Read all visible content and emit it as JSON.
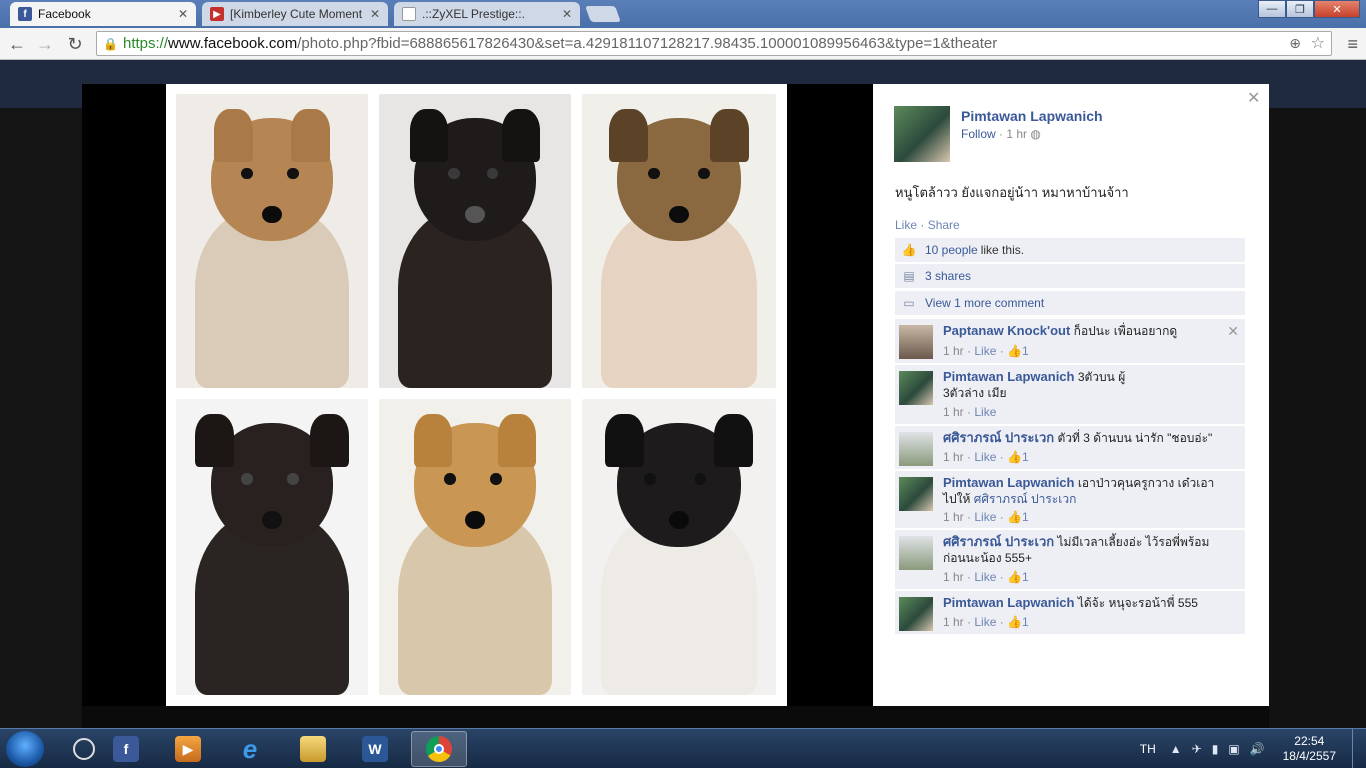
{
  "tabs": [
    {
      "label": "Facebook",
      "icon": "facebook-icon",
      "active": true
    },
    {
      "label": "[Kimberley Cute Moment",
      "icon": "youtube-icon",
      "active": false
    },
    {
      "label": ".::ZyXEL Prestige::.",
      "icon": "page-icon",
      "active": false
    }
  ],
  "window": {
    "minimize": "—",
    "maximize": "❐",
    "close": "✕"
  },
  "omnibox": {
    "scheme": "https://",
    "host": "www.facebook.com",
    "path": "/photo.php?fbid=688865617826430&set=a.429181107128217.98435.100001089956463&type=1&theater"
  },
  "post": {
    "owner_name": "Pimtawan Lapwanich",
    "follow": "Follow",
    "separator": " · ",
    "time": "1 hr",
    "caption": "หนูโตล้าวว ยังแจกอยู่น้าา หมาหาบ้านจ้าา",
    "like": "Like",
    "share": "Share",
    "likes_link": "10 people",
    "likes_text": "like this.",
    "shares": "3 shares",
    "more_comments": "View 1 more comment"
  },
  "comments": [
    {
      "name": "Paptanaw Knock'out",
      "text": "ก็อปนะ เพื่อนอยากดู",
      "time": "1 hr",
      "like": "Like",
      "likes": "1",
      "closable": true
    },
    {
      "name": "Pimtawan Lapwanich",
      "text": "3ตัวบน ผู้",
      "text2": "3ตัวล่าง เมีย",
      "time": "1 hr",
      "like": "Like",
      "likes": ""
    },
    {
      "name": "ศศิราภรณ์ ปาระเวก",
      "text": "ตัวที่ 3 ด้านบน น่ารัก \"ชอบอ่ะ\"",
      "time": "1 hr",
      "like": "Like",
      "likes": "1"
    },
    {
      "name": "Pimtawan Lapwanich",
      "text": "เอาป่าวคุนครูกวาง เด๋วเอา",
      "text2_plain": "ไปให้ ",
      "text2_link": "ศศิราภรณ์ ปาระเวก",
      "time": "1 hr",
      "like": "Like",
      "likes": "1"
    },
    {
      "name": "ศศิราภรณ์ ปาระเวก",
      "text": "ไม่มีเวลาเลี้ยงอ่ะ ไว้รอพี่พร้อม",
      "text2": "ก่อนนะน้อง 555+",
      "time": "1 hr",
      "like": "Like",
      "likes": "1"
    },
    {
      "name": "Pimtawan Lapwanich",
      "text": "ได้จ้ะ หนุจะรอน้าพี่ 555",
      "time": "1 hr",
      "like": "Like",
      "likes": "1"
    }
  ],
  "taskbar": {
    "items": [
      "facebook-icon",
      "media-player-icon",
      "ie-icon",
      "explorer-icon",
      "word-icon",
      "chrome-icon"
    ],
    "word_letter": "W",
    "fb_letter": "f",
    "ie_letter": "e",
    "lang": "TH",
    "time": "22:54",
    "date": "18/4/2557"
  },
  "colors": {
    "fb_blue": "#3b5998",
    "link": "#6d84b4",
    "panel_bg": "#edeff4"
  }
}
